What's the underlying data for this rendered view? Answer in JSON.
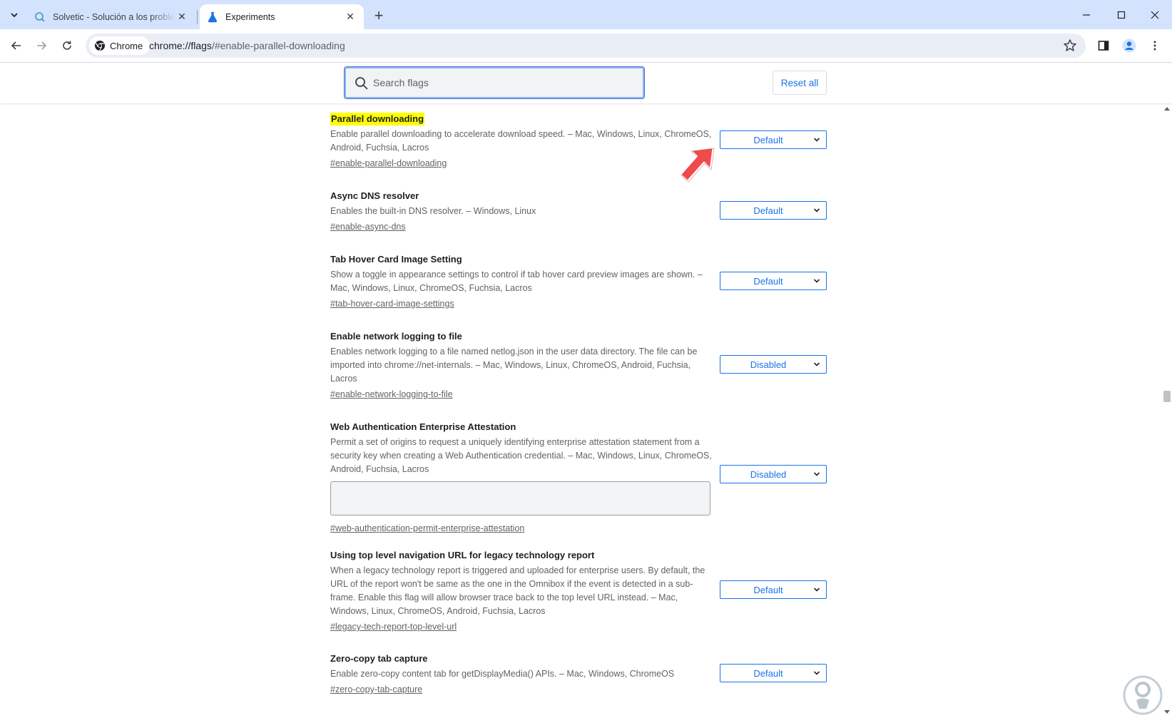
{
  "tabs": [
    {
      "title": "Solvetic - Solución a los problemas",
      "active": false
    },
    {
      "title": "Experiments",
      "active": true
    }
  ],
  "toolbar": {
    "chip_label": "Chrome",
    "url_host": "chrome://flags",
    "url_path": "/#enable-parallel-downloading"
  },
  "flags_header": {
    "search_placeholder": "Search flags",
    "reset_label": "Reset all"
  },
  "experiments": [
    {
      "name": "Parallel downloading",
      "highlighted": true,
      "description": "Enable parallel downloading to accelerate download speed. – Mac, Windows, Linux, ChromeOS, Android, Fuchsia, Lacros",
      "link": "#enable-parallel-downloading",
      "value": "Default"
    },
    {
      "name": "Async DNS resolver",
      "description": "Enables the built-in DNS resolver. – Windows, Linux",
      "link": "#enable-async-dns",
      "value": "Default"
    },
    {
      "name": "Tab Hover Card Image Setting",
      "description": "Show a toggle in appearance settings to control if tab hover card preview images are shown. – Mac, Windows, Linux, ChromeOS, Fuchsia, Lacros",
      "link": "#tab-hover-card-image-settings",
      "value": "Default"
    },
    {
      "name": "Enable network logging to file",
      "description": "Enables network logging to a file named netlog.json in the user data directory. The file can be imported into chrome://net-internals. – Mac, Windows, Linux, ChromeOS, Android, Fuchsia, Lacros",
      "link": "#enable-network-logging-to-file",
      "value": "Disabled"
    },
    {
      "name": "Web Authentication Enterprise Attestation",
      "description": "Permit a set of origins to request a uniquely identifying enterprise attestation statement from a security key when creating a Web Authentication credential. – Mac, Windows, Linux, ChromeOS, Android, Fuchsia, Lacros",
      "link": "#web-authentication-permit-enterprise-attestation",
      "value": "Disabled",
      "has_textarea": true
    },
    {
      "name": "Using top level navigation URL for legacy technology report",
      "description": "When a legacy technology report is triggered and uploaded for enterprise users. By default, the URL of the report won't be same as the one in the Omnibox if the event is detected in a sub-frame. Enable this flag will allow browser trace back to the top level URL instead. – Mac, Windows, Linux, ChromeOS, Android, Fuchsia, Lacros",
      "link": "#legacy-tech-report-top-level-url",
      "value": "Default"
    },
    {
      "name": "Zero-copy tab capture",
      "description": "Enable zero-copy content tab for getDisplayMedia() APIs. – Mac, Windows, ChromeOS",
      "link": "#zero-copy-tab-capture",
      "value": "Default"
    }
  ],
  "colors": {
    "tabstrip": "#d3e3fd",
    "accent": "#1a73e8",
    "highlight": "#ffff00",
    "arrow": "#f04a4a"
  },
  "icons": {
    "tab_search": "chevron-down-icon",
    "inactive_tab": "solvetic-favicon-icon",
    "active_tab": "flask-icon",
    "annotation": "red-arrow-icon"
  }
}
